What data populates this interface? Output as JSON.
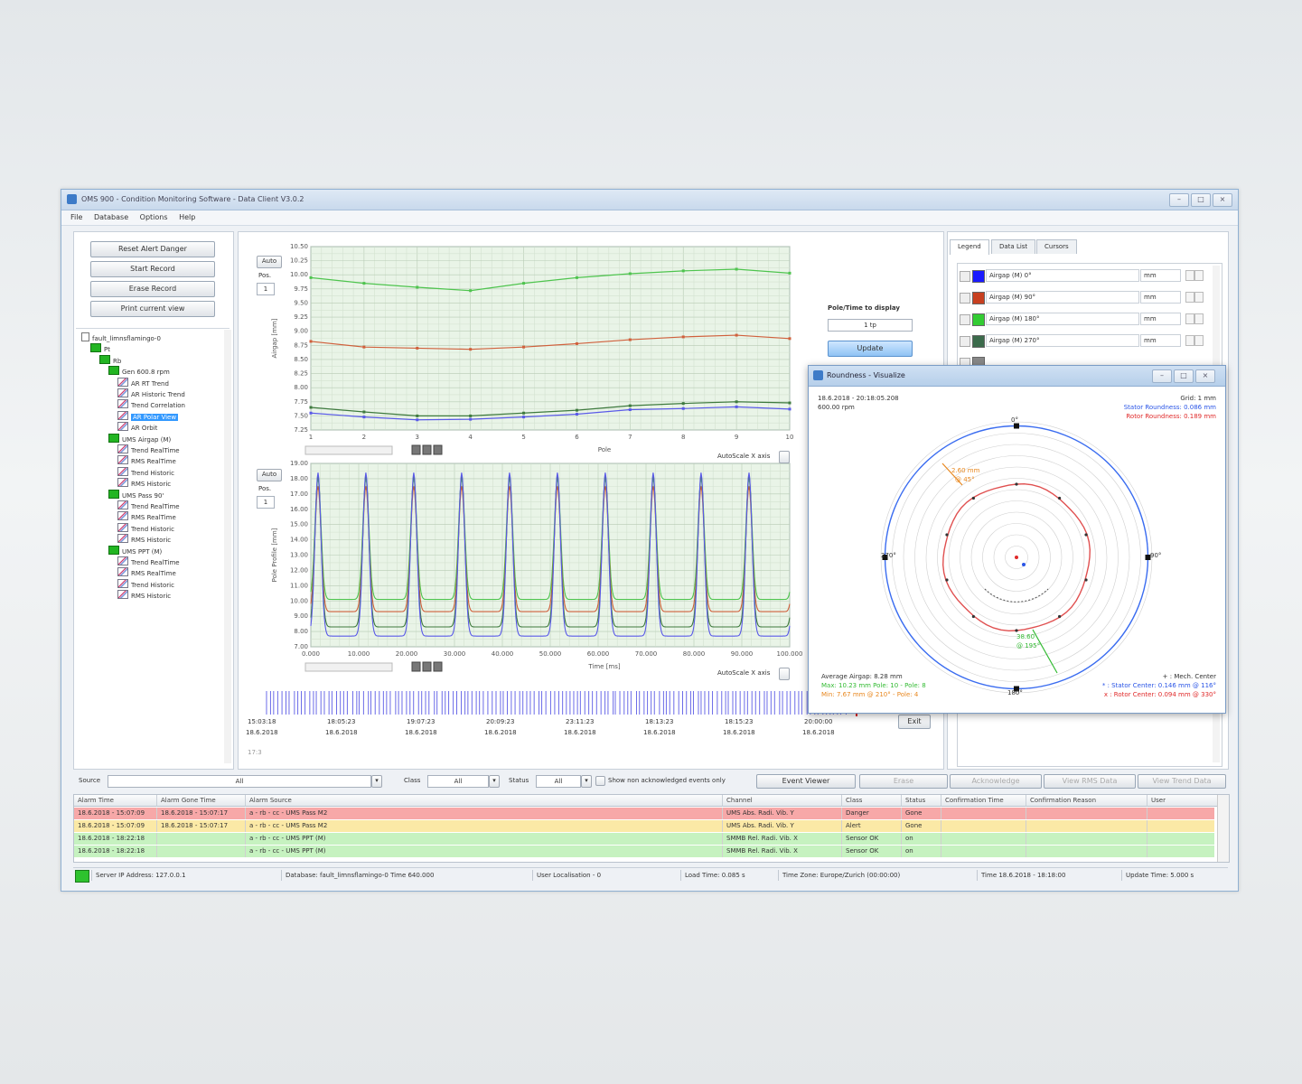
{
  "window": {
    "title": "OMS 900 - Condition Monitoring Software - Data Client V3.0.2",
    "controls": [
      "–",
      "□",
      "×"
    ]
  },
  "menu": [
    "File",
    "Database",
    "Options",
    "Help"
  ],
  "left_buttons": [
    "Reset Alert Danger",
    "Start Record",
    "Erase Record",
    "Print current view"
  ],
  "tree": [
    {
      "label": "fault_limnsflamingo-0",
      "icon": "doc",
      "depth": 0
    },
    {
      "label": "Pt",
      "icon": "grn",
      "depth": 1
    },
    {
      "label": "Rb",
      "icon": "grn",
      "depth": 2
    },
    {
      "label": "Gen 600.8 rpm",
      "icon": "grn",
      "depth": 3
    },
    {
      "label": "AR RT Trend",
      "icon": "chart",
      "depth": 4
    },
    {
      "label": "AR Historic Trend",
      "icon": "chart",
      "depth": 4
    },
    {
      "label": "Trend Correlation",
      "icon": "chart",
      "depth": 4
    },
    {
      "label": "AR Polar View",
      "icon": "chart",
      "depth": 4,
      "selected": true
    },
    {
      "label": "AR Orbit",
      "icon": "chart",
      "depth": 4
    },
    {
      "label": "UMS Airgap (M)",
      "icon": "grn",
      "depth": 3
    },
    {
      "label": "Trend RealTime",
      "icon": "chart",
      "depth": 4
    },
    {
      "label": "RMS RealTime",
      "icon": "chart",
      "depth": 4
    },
    {
      "label": "Trend Historic",
      "icon": "chart",
      "depth": 4
    },
    {
      "label": "RMS Historic",
      "icon": "chart",
      "depth": 4
    },
    {
      "label": "UMS Pass 90'",
      "icon": "grn",
      "depth": 3
    },
    {
      "label": "Trend RealTime",
      "icon": "chart",
      "depth": 4
    },
    {
      "label": "RMS RealTime",
      "icon": "chart",
      "depth": 4
    },
    {
      "label": "Trend Historic",
      "icon": "chart",
      "depth": 4
    },
    {
      "label": "RMS Historic",
      "icon": "chart",
      "depth": 4
    },
    {
      "label": "UMS PPT (M)",
      "icon": "grn",
      "depth": 3
    },
    {
      "label": "Trend RealTime",
      "icon": "chart",
      "depth": 4
    },
    {
      "label": "RMS RealTime",
      "icon": "chart",
      "depth": 4
    },
    {
      "label": "Trend Historic",
      "icon": "chart",
      "depth": 4
    },
    {
      "label": "RMS Historic",
      "icon": "chart",
      "depth": 4
    }
  ],
  "chart_controls": {
    "auto": "Auto",
    "pos": "Pos.",
    "autoscale": "AutoScale X axis",
    "spin": "1"
  },
  "chart_data": [
    {
      "type": "line",
      "ylabel": "Airgap [mm]",
      "xlabel": "Pole",
      "ylim": [
        7.25,
        10.5
      ],
      "xlim": [
        1,
        10
      ],
      "yticks": [
        "10.50",
        "10.25",
        "10.00",
        "9.75",
        "9.50",
        "9.25",
        "9.00",
        "8.75",
        "8.50",
        "8.25",
        "8.00",
        "7.75",
        "7.50",
        "7.25"
      ],
      "xticks": [
        "1",
        "2",
        "3",
        "4",
        "5",
        "6",
        "7",
        "8",
        "9",
        "10"
      ],
      "series": [
        {
          "color": "#4ec44e",
          "x": [
            1,
            2,
            3,
            4,
            5,
            6,
            7,
            8,
            9,
            10
          ],
          "y": [
            9.95,
            9.85,
            9.78,
            9.72,
            9.85,
            9.95,
            10.02,
            10.07,
            10.1,
            10.03
          ]
        },
        {
          "color": "#d0603c",
          "x": [
            1,
            2,
            3,
            4,
            5,
            6,
            7,
            8,
            9,
            10
          ],
          "y": [
            8.82,
            8.72,
            8.7,
            8.68,
            8.72,
            8.78,
            8.85,
            8.9,
            8.93,
            8.87
          ]
        },
        {
          "color": "#3e7a3e",
          "x": [
            1,
            2,
            3,
            4,
            5,
            6,
            7,
            8,
            9,
            10
          ],
          "y": [
            7.65,
            7.57,
            7.5,
            7.5,
            7.55,
            7.6,
            7.68,
            7.72,
            7.75,
            7.73
          ]
        },
        {
          "color": "#5a5ae8",
          "x": [
            1,
            2,
            3,
            4,
            5,
            6,
            7,
            8,
            9,
            10
          ],
          "y": [
            7.55,
            7.48,
            7.43,
            7.44,
            7.48,
            7.53,
            7.61,
            7.63,
            7.66,
            7.62
          ]
        }
      ]
    },
    {
      "type": "line",
      "ylabel": "Pole Profile [mm]",
      "xlabel": "Time [ms]",
      "ylim": [
        7.0,
        19.0
      ],
      "xlim": [
        0,
        100000
      ],
      "yticks": [
        "19.00",
        "18.00",
        "17.00",
        "16.00",
        "15.00",
        "14.00",
        "13.00",
        "12.00",
        "11.00",
        "10.00",
        "9.00",
        "8.00",
        "7.00"
      ],
      "xticks": [
        "0.000",
        "10.000",
        "20.000",
        "30.000",
        "40.000",
        "50.000",
        "60.000",
        "70.000",
        "80.000",
        "90.000",
        "100.000"
      ],
      "periods": 10,
      "series": [
        {
          "color": "#4ec44e",
          "base": 10.1,
          "peak": 18.0
        },
        {
          "color": "#d0603c",
          "base": 9.3,
          "peak": 17.5
        },
        {
          "color": "#3e7a3e",
          "base": 8.3,
          "peak": 18.2
        },
        {
          "color": "#5a5ae8",
          "base": 7.7,
          "peak": 18.4
        }
      ]
    }
  ],
  "timeline": {
    "labels": [
      [
        "15:03:18",
        "18.6.2018"
      ],
      [
        "18:05:23",
        "18.6.2018"
      ],
      [
        "19:07:23",
        "18.6.2018"
      ],
      [
        "20:09:23",
        "18.6.2018"
      ],
      [
        "23:11:23",
        "18.6.2018"
      ],
      [
        "18:13:23",
        "18.6.2018"
      ],
      [
        "18:15:23",
        "18.6.2018"
      ],
      [
        "20:00:00",
        "18.6.2018"
      ]
    ],
    "left_tick": "17:3",
    "button": "Exit"
  },
  "pole_time": {
    "title": "Pole/Time to display",
    "input_value": "1 tp",
    "button": "Update"
  },
  "legend_tabs": [
    "Legend",
    "Data List",
    "Cursors"
  ],
  "legend": [
    {
      "color": "#1a1aff",
      "name": "Airgap (M) 0°",
      "unit": "mm"
    },
    {
      "color": "#c84020",
      "name": "Airgap (M) 90°",
      "unit": "mm"
    },
    {
      "color": "#33cc33",
      "name": "Airgap (M) 180°",
      "unit": "mm"
    },
    {
      "color": "#3b6b4b",
      "name": "Airgap (M) 270°",
      "unit": "mm"
    },
    {
      "color": "#888888",
      "name": "",
      "unit": ""
    }
  ],
  "polar": {
    "title": "Roundness - Visualize",
    "info_left": [
      "18.6.2018 - 20:18:05.208",
      "600.00 rpm"
    ],
    "info_right": [
      "Grid: 1 mm",
      "Stator Roundness: 0.086 mm",
      "Rotor Roundness: 0.189 mm"
    ],
    "angle_labels": [
      "0°",
      "90°",
      "180°",
      "270°"
    ],
    "callout_orange": [
      "2.60 mm",
      "@ 45°"
    ],
    "callout_green": [
      "38.60",
      "@ 195°"
    ],
    "bottom_left": [
      "Average Airgap: 8.28 mm",
      "Max: 10.23 mm Pole: 10 - Pole: 8",
      "Min: 7.67 mm @ 210° - Pole: 4"
    ],
    "bottom_right": [
      "+ : Mech. Center",
      "* : Stator Center: 0.146 mm @ 116°",
      "x : Rotor Center: 0.094 mm @ 330°"
    ]
  },
  "filters": {
    "source_label": "Source",
    "source_value": "All",
    "class_label": "Class",
    "class_value": "All",
    "status_label": "Status",
    "status_value": "All",
    "checkbox_label": "Show non acknowledged events only",
    "buttons": [
      "Event Viewer",
      "Erase",
      "Acknowledge",
      "View RMS Data",
      "View Trend Data"
    ]
  },
  "alarm_table": {
    "columns": [
      "Alarm Time",
      "Alarm Gone Time",
      "Alarm Source",
      "Channel",
      "Class",
      "Status",
      "Confirmation Time",
      "Confirmation Reason",
      "User"
    ],
    "rows": [
      {
        "bg": "#f7a8a8",
        "cells": [
          "18.6.2018 - 15:07:09",
          "18.6.2018 - 15:07:17",
          "a - rb - cc - UMS Pass M2",
          "UMS Abs. Radi. Vib. Y",
          "Danger",
          "Gone",
          "",
          "",
          ""
        ]
      },
      {
        "bg": "#fbe9a6",
        "cells": [
          "18.6.2018 - 15:07:09",
          "18.6.2018 - 15:07:17",
          "a - rb - cc - UMS Pass M2",
          "UMS Abs. Radi. Vib. Y",
          "Alert",
          "Gone",
          "",
          "",
          ""
        ]
      },
      {
        "bg": "#c6f2c0",
        "cells": [
          "18.6.2018 - 18:22:18",
          "",
          "a - rb - cc - UMS PPT (M)",
          "SMMB Rel. Radi. Vib. X",
          "Sensor OK",
          "on",
          "",
          "",
          ""
        ]
      },
      {
        "bg": "#c6f2c0",
        "cells": [
          "18.6.2018 - 18:22:18",
          "",
          "a - rb - cc - UMS PPT (M)",
          "SMMB Rel. Radi. Vib. X",
          "Sensor OK",
          "on",
          "",
          "",
          ""
        ]
      }
    ]
  },
  "statusbar": [
    "Server IP Address: 127.0.0.1",
    "Database: fault_limnsflamingo-0  Time 640.000",
    "User Localisation - 0",
    "Load Time: 0.085 s",
    "Time Zone: Europe/Zurich (00:00:00)",
    "Time 18.6.2018 - 18:18:00",
    "Update Time: 5.000 s"
  ]
}
